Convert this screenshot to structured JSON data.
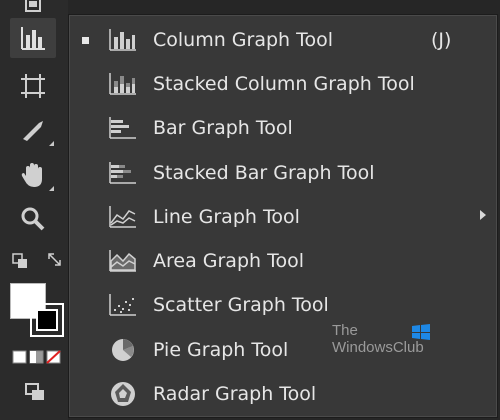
{
  "toolbar": {
    "tools": [
      {
        "name": "document-icon"
      },
      {
        "name": "column-graph-icon",
        "active": true
      },
      {
        "name": "artboard-icon"
      },
      {
        "name": "slice-icon"
      },
      {
        "name": "hand-icon"
      },
      {
        "name": "zoom-icon"
      }
    ],
    "fill_color": "#ffffff",
    "stroke_color": "#000000"
  },
  "flyout": {
    "items": [
      {
        "label": "Column Graph Tool",
        "shortcut": "(J)",
        "icon": "column-graph-icon",
        "selected": true
      },
      {
        "label": "Stacked Column Graph Tool",
        "icon": "stacked-column-graph-icon"
      },
      {
        "label": "Bar Graph Tool",
        "icon": "bar-graph-icon"
      },
      {
        "label": "Stacked Bar Graph Tool",
        "icon": "stacked-bar-graph-icon"
      },
      {
        "label": "Line Graph Tool",
        "icon": "line-graph-icon"
      },
      {
        "label": "Area Graph Tool",
        "icon": "area-graph-icon"
      },
      {
        "label": "Scatter Graph Tool",
        "icon": "scatter-graph-icon"
      },
      {
        "label": "Pie Graph Tool",
        "icon": "pie-graph-icon"
      },
      {
        "label": "Radar Graph Tool",
        "icon": "radar-graph-icon"
      }
    ]
  },
  "watermark": {
    "line1": "The",
    "line2": "WindowsClub"
  },
  "colors": {
    "background": "#262626",
    "menu_bg": "#383838",
    "text": "#e6e6e6",
    "watermark_blue": "#1e88e5"
  }
}
